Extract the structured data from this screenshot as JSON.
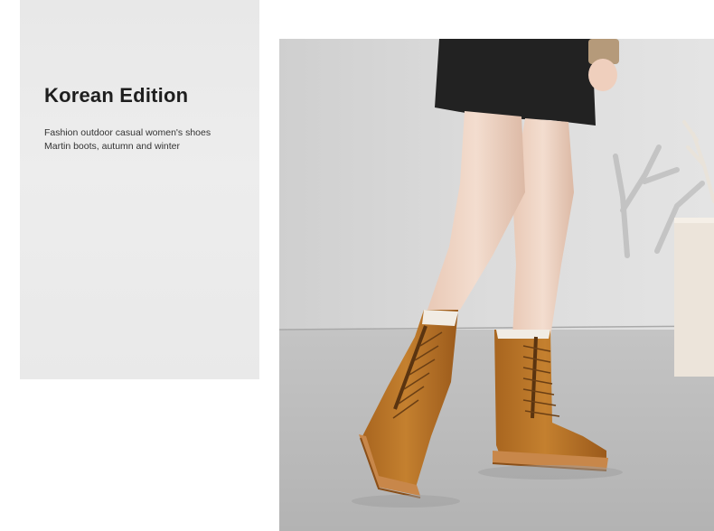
{
  "promo": {
    "title": "Korean Edition",
    "subtitle_line1": "Fashion outdoor casual women's shoes",
    "subtitle_line2": "Martin boots, autumn and winter"
  },
  "colors": {
    "card_background": "#ebebeb",
    "title_text": "#1e1e1e",
    "boot_leather": "#b8742a",
    "sole": "#c8874a",
    "floor": "#bdbdbd",
    "wall": "#d6d6d6"
  },
  "photo": {
    "subject": "woman-wearing-tan-lace-up-martin-boots"
  }
}
